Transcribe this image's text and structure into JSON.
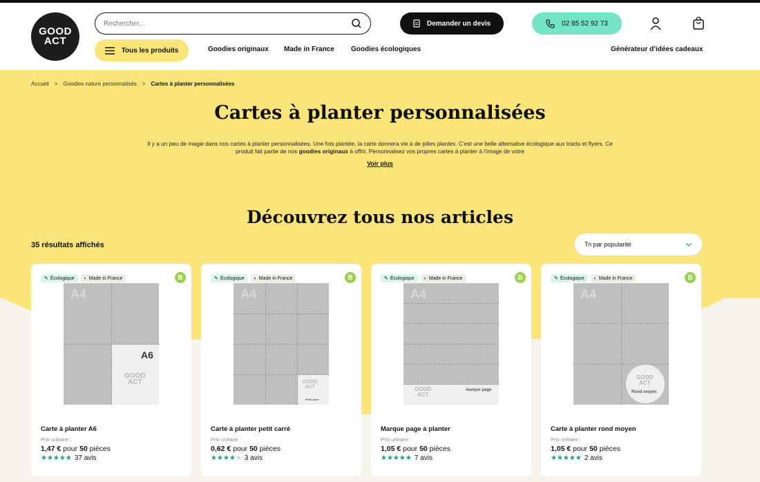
{
  "header": {
    "logo_line1": "GOOD",
    "logo_line2": "ACT",
    "search_placeholder": "Rechercher...",
    "quote_button": "Demander un devis",
    "phone": "02 85 52 92 73",
    "all_products": "Tous les produits",
    "nav": [
      "Goodies originaux",
      "Made in France",
      "Goodies écologiques"
    ],
    "gift_generator": "Générateur d’idées cadeaux"
  },
  "breadcrumb": [
    "Accueil",
    "Goodies nature personnalisés",
    "Cartes à planter personnalisées"
  ],
  "breadcrumb_sep": ">",
  "hero": {
    "title": "Cartes à planter personnalisées",
    "desc_part1": "Il y a un peu de magie dans nos cartes à planter personnalisées. Une fois plantée, la carte donnera vie à de jolies plantes. C’est une belle alternative écologique aux tracts et flyers. Ce produit fait partie de nos ",
    "desc_bold": "goodies originaux",
    "desc_part2": " à offrir. Personnalisez vos propres cartes à planter à l’image de votre",
    "more": "Voir plus",
    "subtitle": "Découvrez tous nos articles",
    "results": "35 résultats affichés",
    "sort": "Tri par popularité"
  },
  "tags": {
    "eco": "Écologique",
    "mif": "Made in France"
  },
  "badge_letter": "B",
  "price_label": "Prix unitaire :",
  "products": [
    {
      "name": "Carte à planter A6",
      "price": "1,47 €",
      "per": "pour",
      "qty": "50",
      "unit": "pièces",
      "stars": 5,
      "reviews": "37 avis",
      "img_a4": "A4",
      "img_tag": "A6"
    },
    {
      "name": "Carte à planter petit carré",
      "price": "0,62 €",
      "per": "pour",
      "qty": "50",
      "unit": "pièces",
      "stars": 4,
      "reviews": "3 avis",
      "img_a4": "A4",
      "img_tag": "Petit carré"
    },
    {
      "name": "Marque page à planter",
      "price": "1,05 €",
      "per": "pour",
      "qty": "50",
      "unit": "pièces",
      "stars": 5,
      "reviews": "7 avis",
      "img_a4": "A4",
      "img_tag": "marque page"
    },
    {
      "name": "Carte à planter rond moyen",
      "price": "1,05 €",
      "per": "pour",
      "qty": "50",
      "unit": "pièces",
      "stars": 5,
      "reviews": "2 avis",
      "img_a4": "A4",
      "img_tag": "Rond moyen"
    }
  ],
  "colors": {
    "yellow": "#fbe57a",
    "mint": "#73e4c6",
    "dark": "#111111",
    "star": "#1d9c7a",
    "badge": "#9ad24a"
  }
}
